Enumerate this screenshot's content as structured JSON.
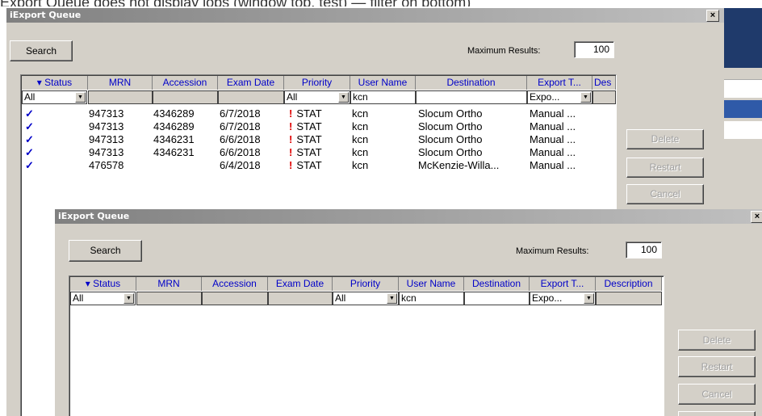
{
  "caption": "Export Queue does not display jobs (window top, test) — filter on bottom)",
  "window1": {
    "title": "iExport Queue",
    "close_glyph": "×",
    "search_label": "Search",
    "max_results_label": "Maximum Results:",
    "max_results_value": "100",
    "columns": [
      "▾ Status",
      "MRN",
      "Accession",
      "Exam Date",
      "Priority",
      "User Name",
      "Destination",
      "Export T...",
      "Des"
    ],
    "filters": {
      "status": "All",
      "priority": "All",
      "user_name": "kcn",
      "export_type": "Expo..."
    },
    "rows": [
      {
        "status": "✓",
        "mrn": "947313",
        "accession": "4346289",
        "exam_date": "6/7/2018",
        "priority_icon": "!",
        "priority": "STAT",
        "user": "kcn",
        "destination": "Slocum Ortho",
        "export_type": "Manual ..."
      },
      {
        "status": "✓",
        "mrn": "947313",
        "accession": "4346289",
        "exam_date": "6/7/2018",
        "priority_icon": "!",
        "priority": "STAT",
        "user": "kcn",
        "destination": "Slocum Ortho",
        "export_type": "Manual ..."
      },
      {
        "status": "✓",
        "mrn": "947313",
        "accession": "4346231",
        "exam_date": "6/6/2018",
        "priority_icon": "!",
        "priority": "STAT",
        "user": "kcn",
        "destination": "Slocum Ortho",
        "export_type": "Manual ..."
      },
      {
        "status": "✓",
        "mrn": "947313",
        "accession": "4346231",
        "exam_date": "6/6/2018",
        "priority_icon": "!",
        "priority": "STAT",
        "user": "kcn",
        "destination": "Slocum Ortho",
        "export_type": "Manual ..."
      },
      {
        "status": "✓",
        "mrn": "476578",
        "accession": "",
        "exam_date": "6/4/2018",
        "priority_icon": "!",
        "priority": "STAT",
        "user": "kcn",
        "destination": "McKenzie-Willa...",
        "export_type": "Manual ..."
      }
    ],
    "buttons": {
      "delete": "Delete",
      "restart": "Restart",
      "cancel": "Cancel"
    }
  },
  "window2": {
    "title": "iExport Queue",
    "close_glyph": "×",
    "search_label": "Search",
    "max_results_label": "Maximum Results:",
    "max_results_value": "100",
    "columns": [
      "▾ Status",
      "MRN",
      "Accession",
      "Exam Date",
      "Priority",
      "User Name",
      "Destination",
      "Export T...",
      "Description"
    ],
    "filters": {
      "status": "All",
      "priority": "All",
      "user_name": "kcn",
      "export_type": "Expo..."
    },
    "buttons": {
      "delete": "Delete",
      "restart": "Restart",
      "cancel": "Cancel"
    }
  },
  "colors": {
    "accent_blue": "#0000c8",
    "stat_red": "#e00000",
    "bg_window_blue": "#1f3a6b"
  }
}
